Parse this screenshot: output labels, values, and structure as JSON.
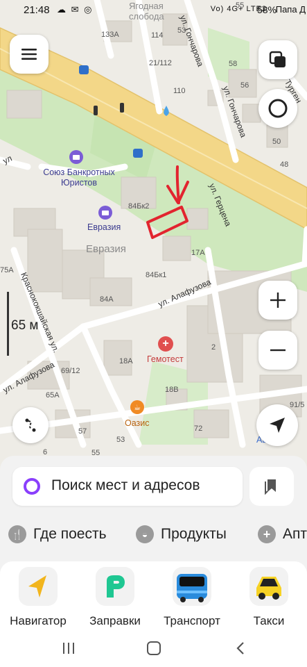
{
  "status_bar": {
    "time": "21:48",
    "left_icons": "☁ ✉ ◎",
    "signal_text": "Vo) 4G+ LTE2",
    "battery": "58%",
    "network_name": "Папа Д"
  },
  "map": {
    "area_labels": [
      "Ягодная слобода",
      "Евразия"
    ],
    "house_numbers": [
      "55",
      "133А",
      "114",
      "53",
      "21/112",
      "58",
      "110",
      "56",
      "50",
      "48",
      "84Бк2",
      "17А",
      "84Бк1",
      "84А",
      "2",
      "18А",
      "69/12",
      "65А",
      "18В",
      "57",
      "53",
      "72",
      "91/5",
      "75А",
      "55",
      "6"
    ],
    "streets": [
      "ул. Гончарова",
      "ул. Гончарова",
      "Турген",
      "ул. Герцена",
      "ул. Алафузова",
      "Краснококшайская ул.",
      "ул. Алафузова",
      "ул"
    ],
    "pois": [
      {
        "name": "Союз Банкротных Юристов",
        "icon": "briefcase-icon"
      },
      {
        "name": "Евразия",
        "icon": "briefcase-icon"
      },
      {
        "name": "Гемотест",
        "icon": "medical-cross-icon"
      },
      {
        "name": "Оазис",
        "icon": "cafe-cup-icon"
      },
      {
        "name": "Автомот",
        "icon": "car-icon"
      }
    ],
    "scale_label": "65 м",
    "accent_road": "#f3d788",
    "greenery": "#c7e6b5"
  },
  "search": {
    "placeholder": "Поиск мест и адресов"
  },
  "chips": [
    {
      "label": "Где поесть",
      "icon": "fork-knife-icon"
    },
    {
      "label": "Продукты",
      "icon": "basket-icon"
    },
    {
      "label": "Апт",
      "icon": "pharmacy-plus-icon"
    }
  ],
  "services": [
    {
      "label": "Навигатор",
      "icon": "navigator-arrow-icon"
    },
    {
      "label": "Заправки",
      "icon": "fuel-p-icon"
    },
    {
      "label": "Транспорт",
      "icon": "bus-icon"
    },
    {
      "label": "Такси",
      "icon": "taxi-car-icon"
    }
  ]
}
